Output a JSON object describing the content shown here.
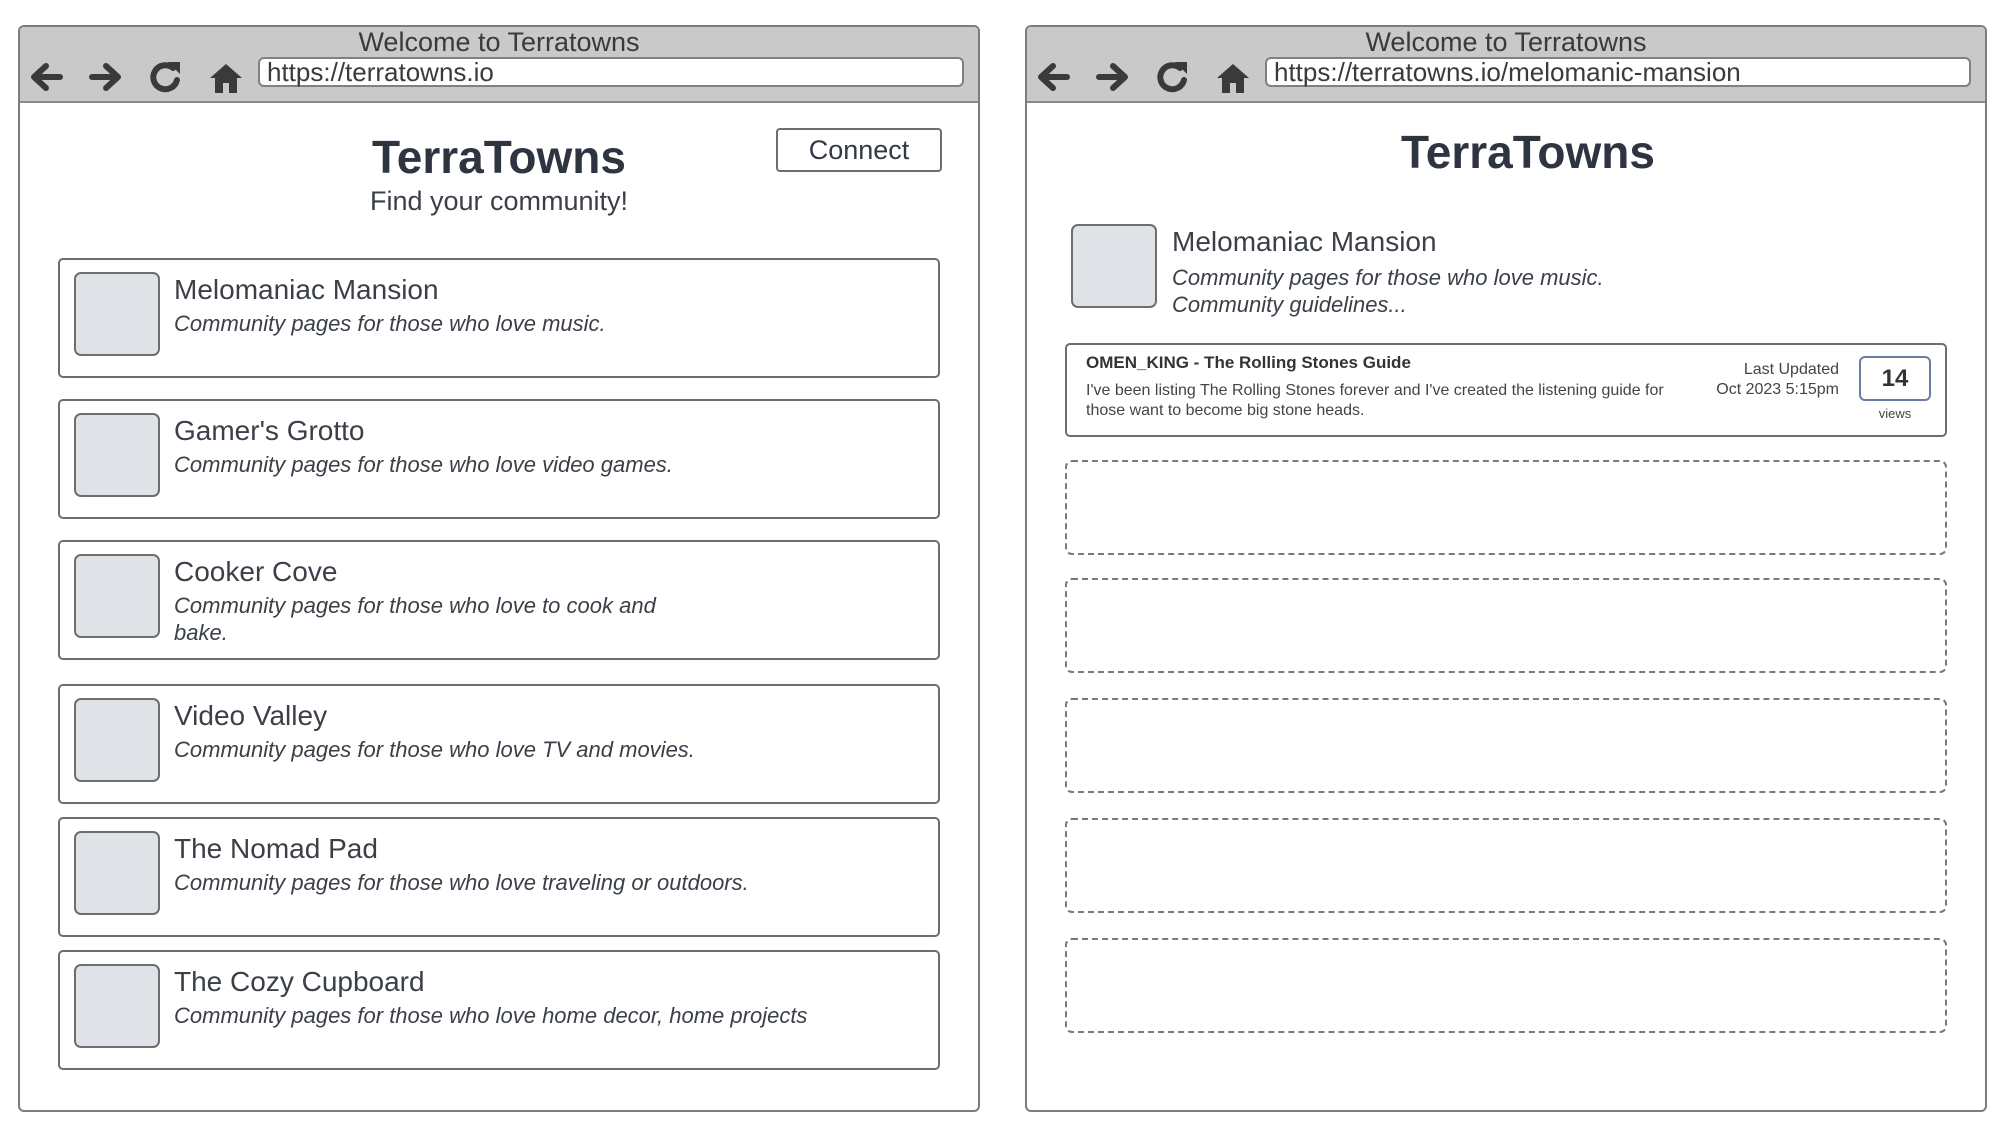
{
  "left_browser": {
    "window_title": "Welcome to Terratowns",
    "url": "https://terratowns.io",
    "page_title": "TerraTowns",
    "subtitle": "Find your community!",
    "connect_label": "Connect",
    "communities": [
      {
        "name": "Melomaniac Mansion",
        "description": "Community pages for those who love music."
      },
      {
        "name": "Gamer's Grotto",
        "description": "Community pages for those who love video games."
      },
      {
        "name": "Cooker Cove",
        "description": "Community pages for those who love to cook and bake."
      },
      {
        "name": "Video Valley",
        "description": "Community pages for those who love TV and movies."
      },
      {
        "name": "The Nomad Pad",
        "description": "Community pages for those who love traveling or outdoors."
      },
      {
        "name": "The Cozy Cupboard",
        "description": "Community pages for those who love home decor, home projects"
      }
    ]
  },
  "right_browser": {
    "window_title": "Welcome to Terratowns",
    "url": "https://terratowns.io/melomanic-mansion",
    "page_title": "TerraTowns",
    "community": {
      "name": "Melomaniac Mansion",
      "description": "Community pages for those who love music.",
      "guidelines": "Community guidelines..."
    },
    "posts": [
      {
        "title": "OMEN_KING - The Rolling Stones Guide",
        "body": "I've been listing The Rolling Stones forever and I've created the listening guide for those want to become big stone heads.",
        "updated_label": "Last Updated",
        "updated_date": "Oct 2023 5:15pm",
        "views": "14",
        "views_label": "views"
      }
    ]
  },
  "icons": {
    "back": "arrow-left-icon",
    "forward": "arrow-right-icon",
    "reload": "reload-icon",
    "home": "home-icon"
  },
  "colors": {
    "chrome_bar": "#c9c9c9",
    "thumbnail": "#dfe3e8",
    "border": "#6e6e6e",
    "views_border": "#6a7da0"
  }
}
